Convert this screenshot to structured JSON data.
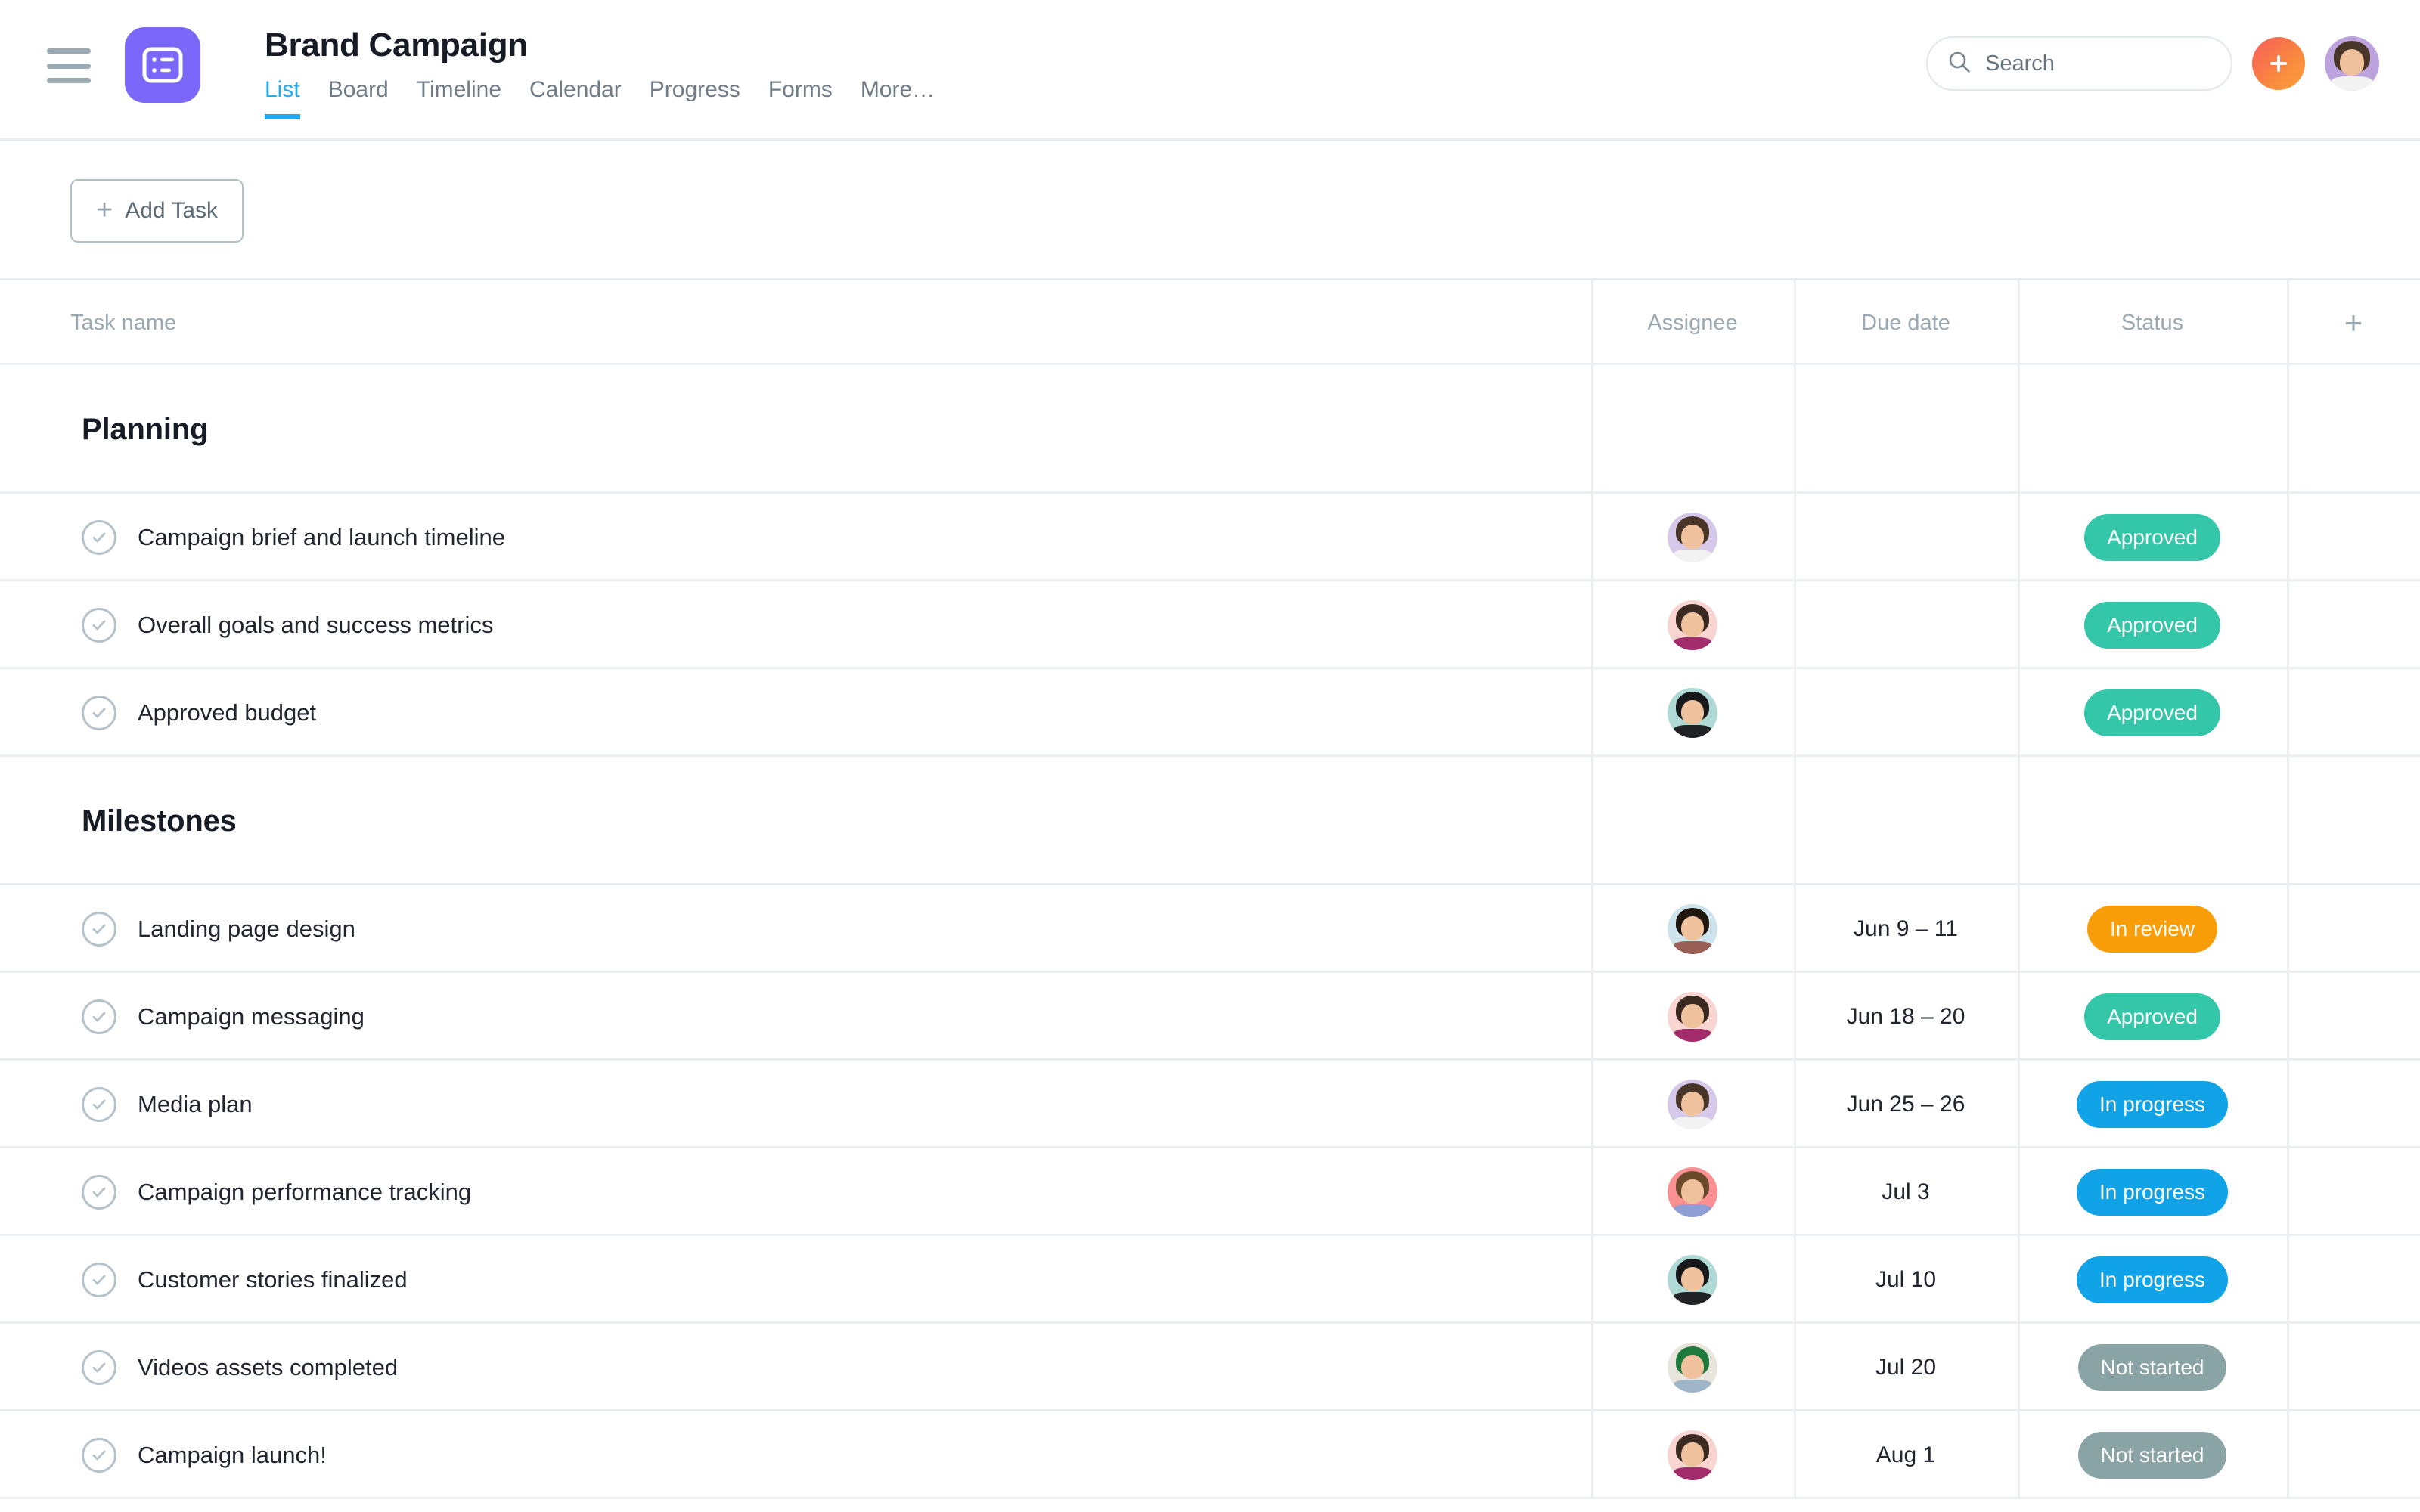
{
  "header": {
    "menu_icon": "hamburger-icon",
    "logo_icon": "list-app-icon",
    "project_title": "Brand Campaign",
    "tabs": [
      {
        "label": "List",
        "active": true
      },
      {
        "label": "Board",
        "active": false
      },
      {
        "label": "Timeline",
        "active": false
      },
      {
        "label": "Calendar",
        "active": false
      },
      {
        "label": "Progress",
        "active": false
      },
      {
        "label": "Forms",
        "active": false
      },
      {
        "label": "More…",
        "active": false
      }
    ],
    "search": {
      "placeholder": "Search",
      "value": "",
      "icon": "search-icon"
    },
    "add_button": {
      "icon": "plus-icon"
    },
    "user_avatar": {
      "name": "user-avatar",
      "bg": "#bda3dd"
    }
  },
  "toolbar": {
    "add_task_label": "Add Task",
    "add_task_icon": "plus-icon"
  },
  "table": {
    "columns": {
      "name": "Task name",
      "assignee": "Assignee",
      "due": "Due date",
      "status": "Status",
      "add_column_icon": "plus-icon"
    },
    "sections": [
      {
        "title": "Planning",
        "rows": [
          {
            "name": "Campaign brief and launch timeline",
            "assignee_bg": "#d6c8e8",
            "assignee_hair": "#4a3628",
            "assignee_body": "#f2f2f2",
            "due": "",
            "status": "Approved",
            "status_color": "#34c6a8"
          },
          {
            "name": "Overall goals and success metrics",
            "assignee_bg": "#f8d5d0",
            "assignee_hair": "#3b2a22",
            "assignee_body": "#a32c6c",
            "due": "",
            "status": "Approved",
            "status_color": "#34c6a8"
          },
          {
            "name": "Approved budget",
            "assignee_bg": "#aed9d5",
            "assignee_hair": "#17181a",
            "assignee_body": "#222326",
            "due": "",
            "status": "Approved",
            "status_color": "#34c6a8"
          }
        ]
      },
      {
        "title": "Milestones",
        "rows": [
          {
            "name": "Landing page design",
            "assignee_bg": "#cfe3ec",
            "assignee_hair": "#20180f",
            "assignee_body": "#9a5f55",
            "due": "Jun 9 – 11",
            "status": "In review",
            "status_color": "#f99d09"
          },
          {
            "name": "Campaign messaging",
            "assignee_bg": "#f8d5d0",
            "assignee_hair": "#3b2a22",
            "assignee_body": "#a32c6c",
            "due": "Jun 18 – 20",
            "status": "Approved",
            "status_color": "#34c6a8"
          },
          {
            "name": "Media plan",
            "assignee_bg": "#d6c8e8",
            "assignee_hair": "#4a3628",
            "assignee_body": "#f2f2f2",
            "due": "Jun 25 – 26",
            "status": "In progress",
            "status_color": "#10a3e8"
          },
          {
            "name": "Campaign performance tracking",
            "assignee_bg": "#fb9093",
            "assignee_hair": "#6b4a2c",
            "assignee_body": "#8f9ed4",
            "due": "Jul 3",
            "status": "In progress",
            "status_color": "#10a3e8"
          },
          {
            "name": "Customer stories finalized",
            "assignee_bg": "#aed9d5",
            "assignee_hair": "#17181a",
            "assignee_body": "#222326",
            "due": "Jul 10",
            "status": "In progress",
            "status_color": "#10a3e8"
          },
          {
            "name": "Videos assets completed",
            "assignee_bg": "#e8e5dc",
            "assignee_hair": "#1f7a3d",
            "assignee_body": "#9fb6c9",
            "due": "Jul 20",
            "status": "Not started",
            "status_color": "#8aa4a6"
          },
          {
            "name": "Campaign launch!",
            "assignee_bg": "#f8d5d0",
            "assignee_hair": "#3b2a22",
            "assignee_body": "#a32c6c",
            "due": "Aug 1",
            "status": "Not started",
            "status_color": "#8aa4a6"
          }
        ]
      }
    ]
  }
}
